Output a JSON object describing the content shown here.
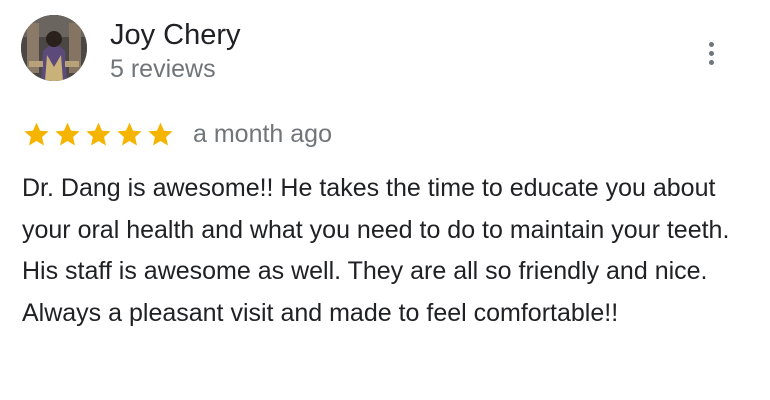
{
  "review": {
    "author_name": "Joy Chery",
    "review_count": "5 reviews",
    "rating": 5,
    "rating_max": 5,
    "date": "a month ago",
    "text": "Dr. Dang is awesome!! He takes the time to educate you about your oral health and what you need to do to maintain your teeth. His staff is awesome as well. They are all so friendly and nice. Always a pleasant visit and made to feel comfortable!!"
  },
  "icons": {
    "star": "star-icon",
    "more": "more-vert-icon"
  },
  "colors": {
    "star": "#f4b400",
    "secondary_text": "#70757a",
    "primary_text": "#202124"
  }
}
